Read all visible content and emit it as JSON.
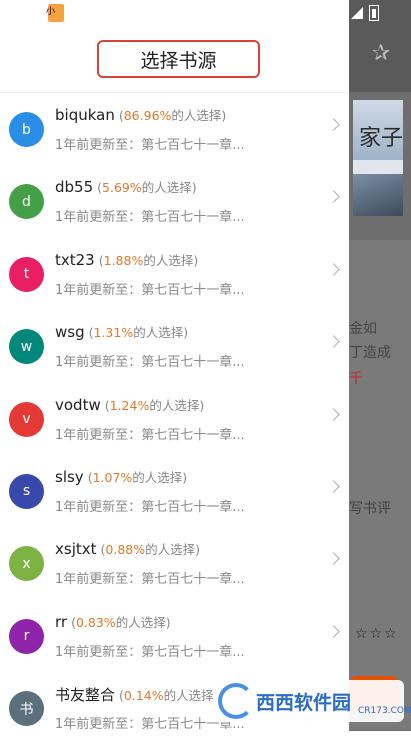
{
  "drawer": {
    "title": "选择书源",
    "sources": [
      {
        "avatar": "b",
        "color": "#2b8ee6",
        "name": "biqukan",
        "percent": "86.96%",
        "suffix": "的人选择)",
        "update": "1年前更新至：第七百七十一章..."
      },
      {
        "avatar": "d",
        "color": "#43a047",
        "name": "db55",
        "percent": "5.69%",
        "suffix": "的人选择)",
        "update": "1年前更新至：第七百七十一章..."
      },
      {
        "avatar": "t",
        "color": "#e91e63",
        "name": "txt23",
        "percent": "1.88%",
        "suffix": "的人选择)",
        "update": "1年前更新至：第七百七十一章..."
      },
      {
        "avatar": "w",
        "color": "#00897b",
        "name": "wsg",
        "percent": "1.31%",
        "suffix": "的人选择)",
        "update": "1年前更新至：第七百七十一章..."
      },
      {
        "avatar": "v",
        "color": "#e53935",
        "name": "vodtw",
        "percent": "1.24%",
        "suffix": "的人选择)",
        "update": "1年前更新至：第七百七十一章..."
      },
      {
        "avatar": "s",
        "color": "#3949ab",
        "name": "slsy",
        "percent": "1.07%",
        "suffix": "的人选择)",
        "update": "1年前更新至：第七百七十一章..."
      },
      {
        "avatar": "x",
        "color": "#7cb342",
        "name": "xsjtxt",
        "percent": "0.88%",
        "suffix": "的人选择)",
        "update": "1年前更新至：第七百七十一章..."
      },
      {
        "avatar": "r",
        "color": "#8e24aa",
        "name": "rr",
        "percent": "0.83%",
        "suffix": "的人选择)",
        "update": "1年前更新至：第七百七十一章..."
      },
      {
        "avatar": "书",
        "color": "#5c6f7d",
        "name": "书友整合",
        "percent": "0.14%",
        "suffix": "的人选择)",
        "update": "1年前更新至：第七百七十一章..."
      }
    ]
  },
  "background": {
    "cover_text": "家子",
    "text_line1": "金如",
    "text_line2": "丁造成",
    "text_line3": "千",
    "review_label": "写书评",
    "stars": "☆☆☆",
    "watermark": "西西软件园",
    "watermark_sub": "CR173.COM"
  }
}
